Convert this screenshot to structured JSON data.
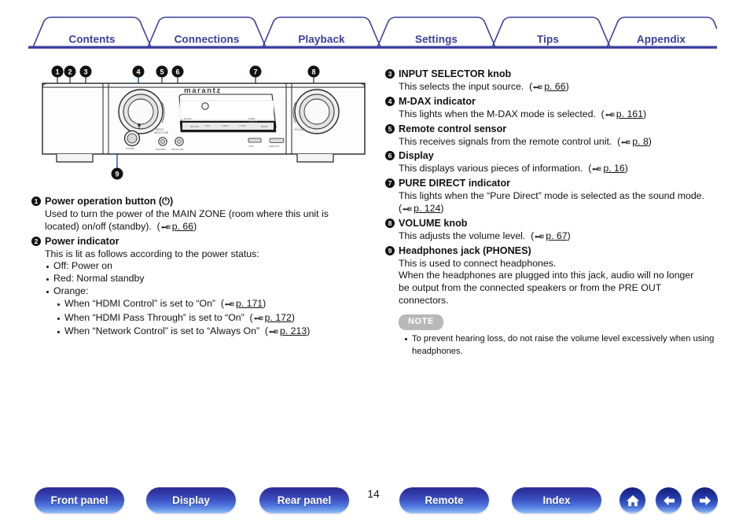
{
  "nav_tabs": [
    {
      "label": "Contents"
    },
    {
      "label": "Connections"
    },
    {
      "label": "Playback"
    },
    {
      "label": "Settings"
    },
    {
      "label": "Tips"
    },
    {
      "label": "Appendix"
    }
  ],
  "figure": {
    "name": "front-panel-diagram",
    "brand_text": "marantz",
    "callouts": [
      "1",
      "2",
      "3",
      "4",
      "5",
      "6",
      "7",
      "8",
      "9"
    ]
  },
  "left_column": [
    {
      "number": "1",
      "title": "Power operation button (⏻)",
      "lines": [
        "Used to turn the power of the MAIN ZONE (room where this unit is",
        "located) on/off (standby)."
      ],
      "ref": "p. 66"
    },
    {
      "number": "2",
      "title": "Power indicator",
      "intro": "This is lit as follows according to the power status:",
      "bullets": [
        {
          "text": "Off: Power on"
        },
        {
          "text": "Red: Normal standby"
        },
        {
          "text": "Orange:"
        }
      ],
      "subbullets": [
        {
          "text": "When “HDMI Control” is set to “On”",
          "ref": "p. 171"
        },
        {
          "text": "When “HDMI Pass Through” is set to “On”",
          "ref": "p. 172"
        },
        {
          "text": "When “Network Control” is set to “Always On”",
          "ref": "p. 213"
        }
      ]
    }
  ],
  "right_column": [
    {
      "number": "3",
      "title": "INPUT SELECTOR knob",
      "body": "This selects the input source.",
      "ref": "p. 66"
    },
    {
      "number": "4",
      "title": "M-DAX indicator",
      "body": "This lights when the M-DAX mode is selected.",
      "ref": "p. 161"
    },
    {
      "number": "5",
      "title": "Remote control sensor",
      "body": "This receives signals from the remote control unit.",
      "ref": "p. 8"
    },
    {
      "number": "6",
      "title": "Display",
      "body": "This displays various pieces of information.",
      "ref": "p. 16"
    },
    {
      "number": "7",
      "title": "PURE DIRECT indicator",
      "body": "This lights when the “Pure Direct” mode is selected as the sound mode.",
      "ref": "p. 124"
    },
    {
      "number": "8",
      "title": "VOLUME knob",
      "body": "This adjusts the volume level.",
      "ref": "p. 67"
    },
    {
      "number": "9",
      "title": "Headphones jack (PHONES)",
      "body_lines": [
        "This is used to connect headphones.",
        "When the headphones are plugged into this jack, audio will no longer",
        "be output from the connected speakers or from the PRE OUT",
        "connectors."
      ]
    }
  ],
  "note": {
    "badge": "NOTE",
    "lines": [
      "To prevent hearing loss, do not raise the volume level excessively when using",
      "headphones."
    ]
  },
  "bottom_bar": {
    "buttons": [
      {
        "label": "Front panel"
      },
      {
        "label": "Display"
      },
      {
        "label": "Rear panel"
      },
      {
        "label": "Remote"
      },
      {
        "label": "Index"
      }
    ],
    "page_number": "14",
    "icons": [
      {
        "name": "home-icon"
      },
      {
        "name": "arrow-left-icon"
      },
      {
        "name": "arrow-right-icon"
      }
    ]
  },
  "colors": {
    "tab_text": "#3b3f9e",
    "tab_line": "#3b3f9e",
    "button_blue": "#2b45b6",
    "note_badge": "#b8b8b8"
  }
}
